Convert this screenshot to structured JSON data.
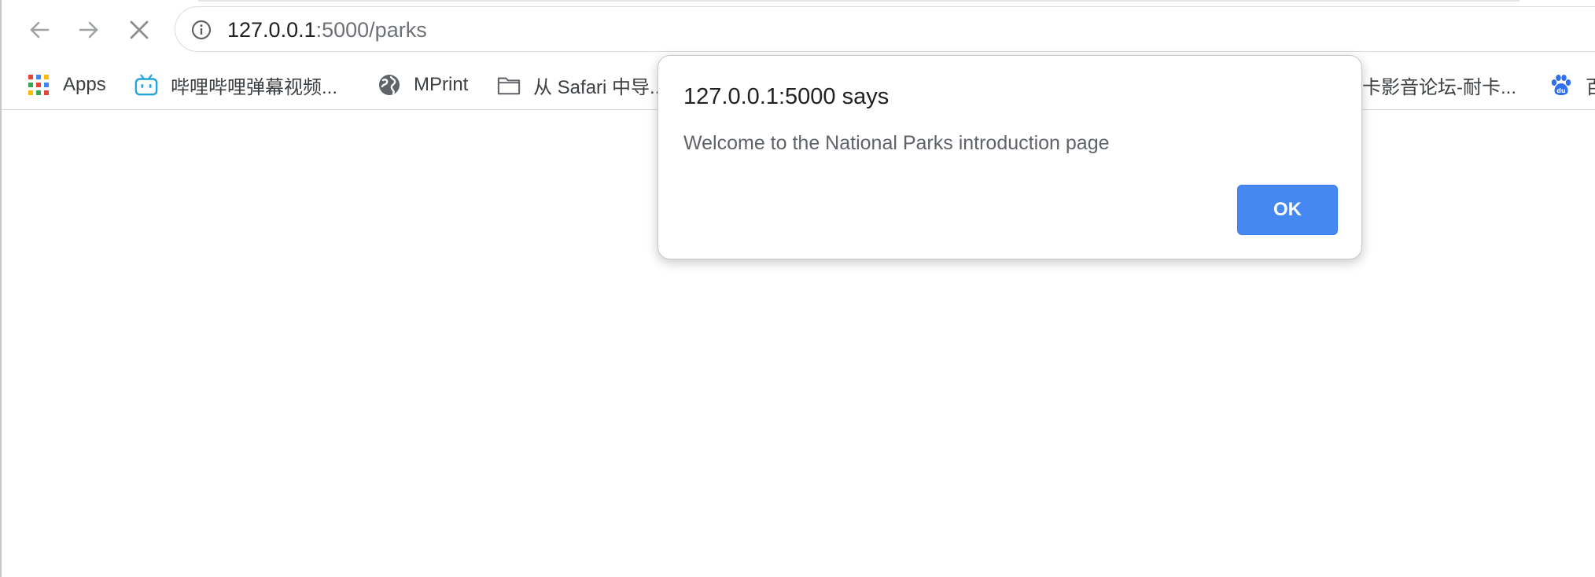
{
  "toolbar": {
    "back_icon": "arrow-left-icon",
    "forward_icon": "arrow-right-icon",
    "stop_icon": "close-icon"
  },
  "omnibox": {
    "icon": "info-icon",
    "url_host": "127.0.0.1",
    "url_rest": ":5000/parks"
  },
  "bookmarks": {
    "items": [
      {
        "label": "Apps",
        "icon": "apps-grid-icon"
      },
      {
        "label": "哔哩哔哩弹幕视频...",
        "icon": "bilibili-icon"
      },
      {
        "label": "MPrint",
        "icon": "globe-icon"
      },
      {
        "label": "从 Safari 中导...",
        "icon": "folder-icon"
      },
      {
        "label": "卡影音论坛-耐卡...",
        "icon": "none"
      },
      {
        "label": "百",
        "icon": "baidu-paw-icon"
      }
    ]
  },
  "dialog": {
    "title": "127.0.0.1:5000 says",
    "message": "Welcome to the National Parks introduction page",
    "ok_label": "OK"
  },
  "colors": {
    "ok_button": "#4688f1",
    "bilibili": "#23a5d9",
    "baidu": "#2f6ff0"
  }
}
